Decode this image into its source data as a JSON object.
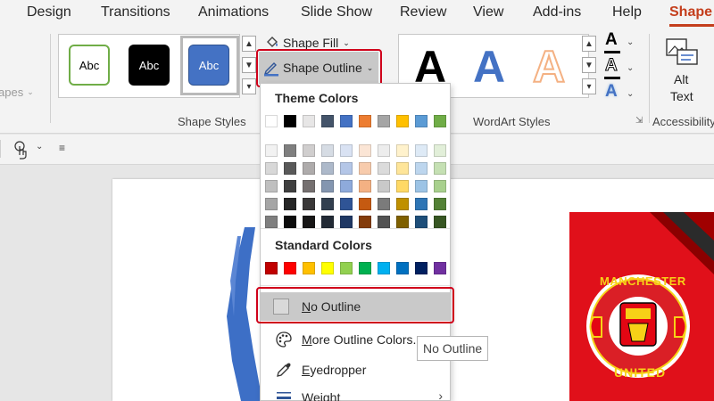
{
  "tabs": [
    {
      "label": "Design"
    },
    {
      "label": "Transitions"
    },
    {
      "label": "Animations"
    },
    {
      "label": "Slide Show"
    },
    {
      "label": "Review"
    },
    {
      "label": "View"
    },
    {
      "label": "Add-ins"
    },
    {
      "label": "Help"
    },
    {
      "label": "Shape",
      "active": true
    }
  ],
  "ribbon": {
    "left_cut_label": "apes",
    "shape_styles": {
      "thumbnails": [
        "Abc",
        "Abc",
        "Abc"
      ],
      "group_label": "Shape Styles"
    },
    "shape_fill_label": "Shape Fill",
    "shape_outline_label": "Shape Outline",
    "wordart": {
      "letters": [
        "A",
        "A",
        "A"
      ],
      "group_label": "WordArt Styles"
    },
    "alt_text": {
      "line1": "Alt",
      "line2": "Text"
    },
    "accessibility_label": "Accessibility"
  },
  "menu": {
    "theme_colors_title": "Theme Colors",
    "theme_top_row": [
      "#ffffff",
      "#000000",
      "#e7e6e6",
      "#44546a",
      "#4472c4",
      "#ed7d31",
      "#a5a5a5",
      "#ffc000",
      "#5b9bd5",
      "#70ad47"
    ],
    "theme_shades": [
      [
        "#f2f2f2",
        "#7f7f7f",
        "#d0cece",
        "#d6dce4",
        "#d9e2f3",
        "#fbe5d5",
        "#ededed",
        "#fff2cc",
        "#deeaf6",
        "#e2efd9"
      ],
      [
        "#d8d8d8",
        "#595959",
        "#aeabab",
        "#adb9ca",
        "#b4c6e7",
        "#f7cbac",
        "#dbdbdb",
        "#fee599",
        "#bdd6ee",
        "#c5e0b3"
      ],
      [
        "#bfbfbf",
        "#3f3f3f",
        "#757070",
        "#8496b0",
        "#8eaadb",
        "#f4b183",
        "#c9c9c9",
        "#ffd965",
        "#9cc3e5",
        "#a8d08d"
      ],
      [
        "#a5a5a5",
        "#262626",
        "#3a3838",
        "#323f4f",
        "#2f5496",
        "#c55a11",
        "#7b7b7b",
        "#bf9000",
        "#2e75b5",
        "#538135"
      ],
      [
        "#7f7f7f",
        "#0c0c0c",
        "#171616",
        "#222a35",
        "#1f3864",
        "#833c0b",
        "#525252",
        "#7f6000",
        "#1e4e79",
        "#375623"
      ]
    ],
    "standard_colors_title": "Standard Colors",
    "standard_colors": [
      "#c00000",
      "#ff0000",
      "#ffc000",
      "#ffff00",
      "#92d050",
      "#00b050",
      "#00b0f0",
      "#0070c0",
      "#002060",
      "#7030a0"
    ],
    "items": {
      "no_outline": {
        "accel": "N",
        "rest": "o Outline"
      },
      "more_outline_colors": {
        "accel": "M",
        "rest": "ore Outline Colors..."
      },
      "eyedropper": {
        "accel": "E",
        "rest": "yedropper"
      },
      "weight": {
        "accel": "W",
        "rest": "eight"
      }
    }
  },
  "tooltip": {
    "text": "No Outline"
  },
  "slide_logo": {
    "top_text": "MANCHESTER",
    "bottom_text": "UNITED"
  }
}
